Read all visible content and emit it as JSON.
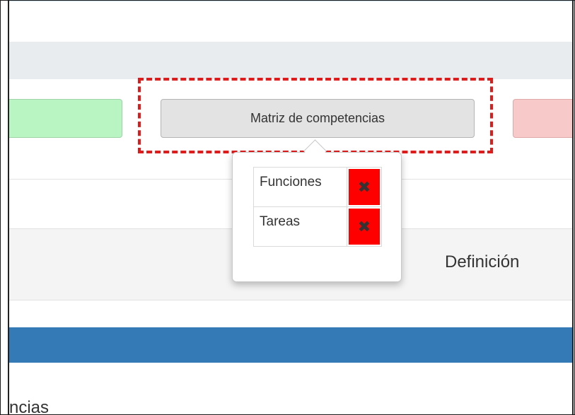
{
  "toolbar": {
    "main_button_label": "Matriz de competencias"
  },
  "popover": {
    "items": [
      {
        "label": "Funciones",
        "delete_icon": "x-icon"
      },
      {
        "label": "Tareas",
        "delete_icon": "x-icon"
      }
    ]
  },
  "content": {
    "column_header": "Definición",
    "bottom_text": "ncias"
  },
  "colors": {
    "accent_blue": "#337ab7",
    "green_button": "#b9f5c3",
    "red_button": "#f8c9c9",
    "delete_red": "#ff0000",
    "highlight_dash": "#e01b1b"
  }
}
